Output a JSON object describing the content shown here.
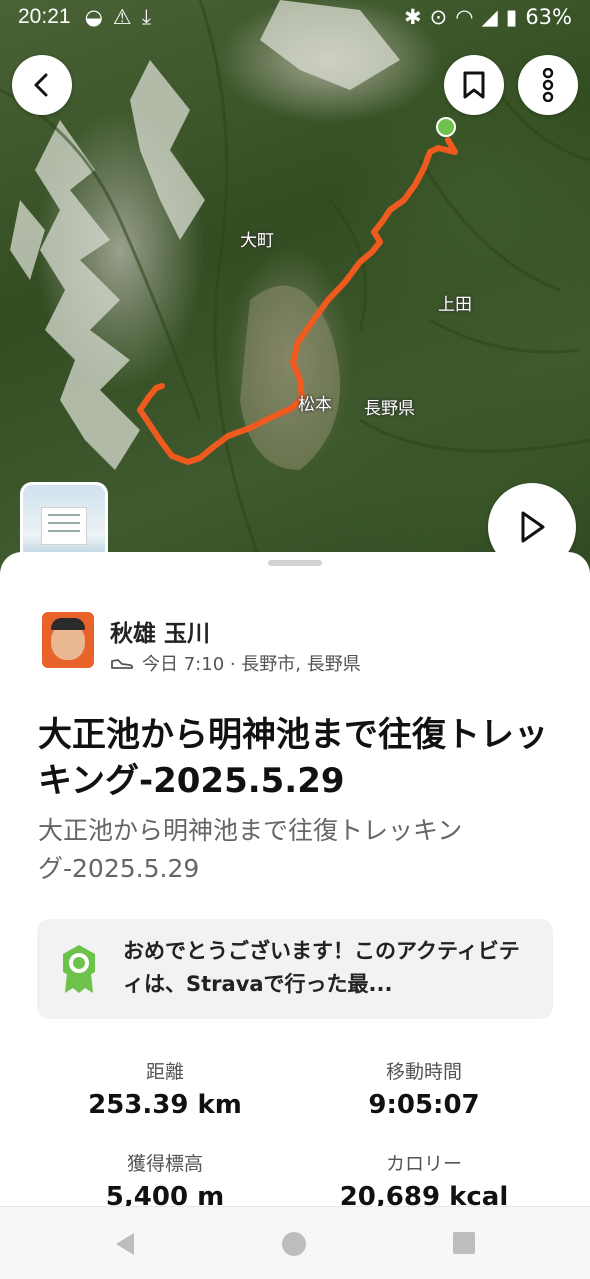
{
  "status_bar": {
    "time": "20:21",
    "battery": "63%"
  },
  "map": {
    "labels": [
      "大町",
      "上田",
      "松本",
      "長野県"
    ],
    "route_color": "#f05a1e",
    "start_color": "#6cc24a"
  },
  "activity": {
    "athlete_name": "秋雄 玉川",
    "meta": "今日 7:10 · 長野市, 長野県",
    "title": "大正池から明神池まで往復トレッキング-2025.5.29",
    "description": "大正池から明神池まで往復トレッキング-2025.5.29",
    "achievement": "おめでとうございます！このアクティビティは、Stravaで行った最..."
  },
  "stats": [
    {
      "label": "距離",
      "value": "253.39 km"
    },
    {
      "label": "移動時間",
      "value": "9:05:07"
    },
    {
      "label": "獲得標高",
      "value": "5,400 m"
    },
    {
      "label": "カロリー",
      "value": "20,689 kcal"
    }
  ],
  "icons": {
    "back": "chevron-left-icon",
    "bookmark": "bookmark-icon",
    "more": "more-vertical-icon",
    "play": "play-icon",
    "shoe": "shoe-icon",
    "badge": "achievement-badge-icon"
  },
  "colors": {
    "accent_orange": "#f05a1e",
    "badge_green": "#6cc24a"
  }
}
